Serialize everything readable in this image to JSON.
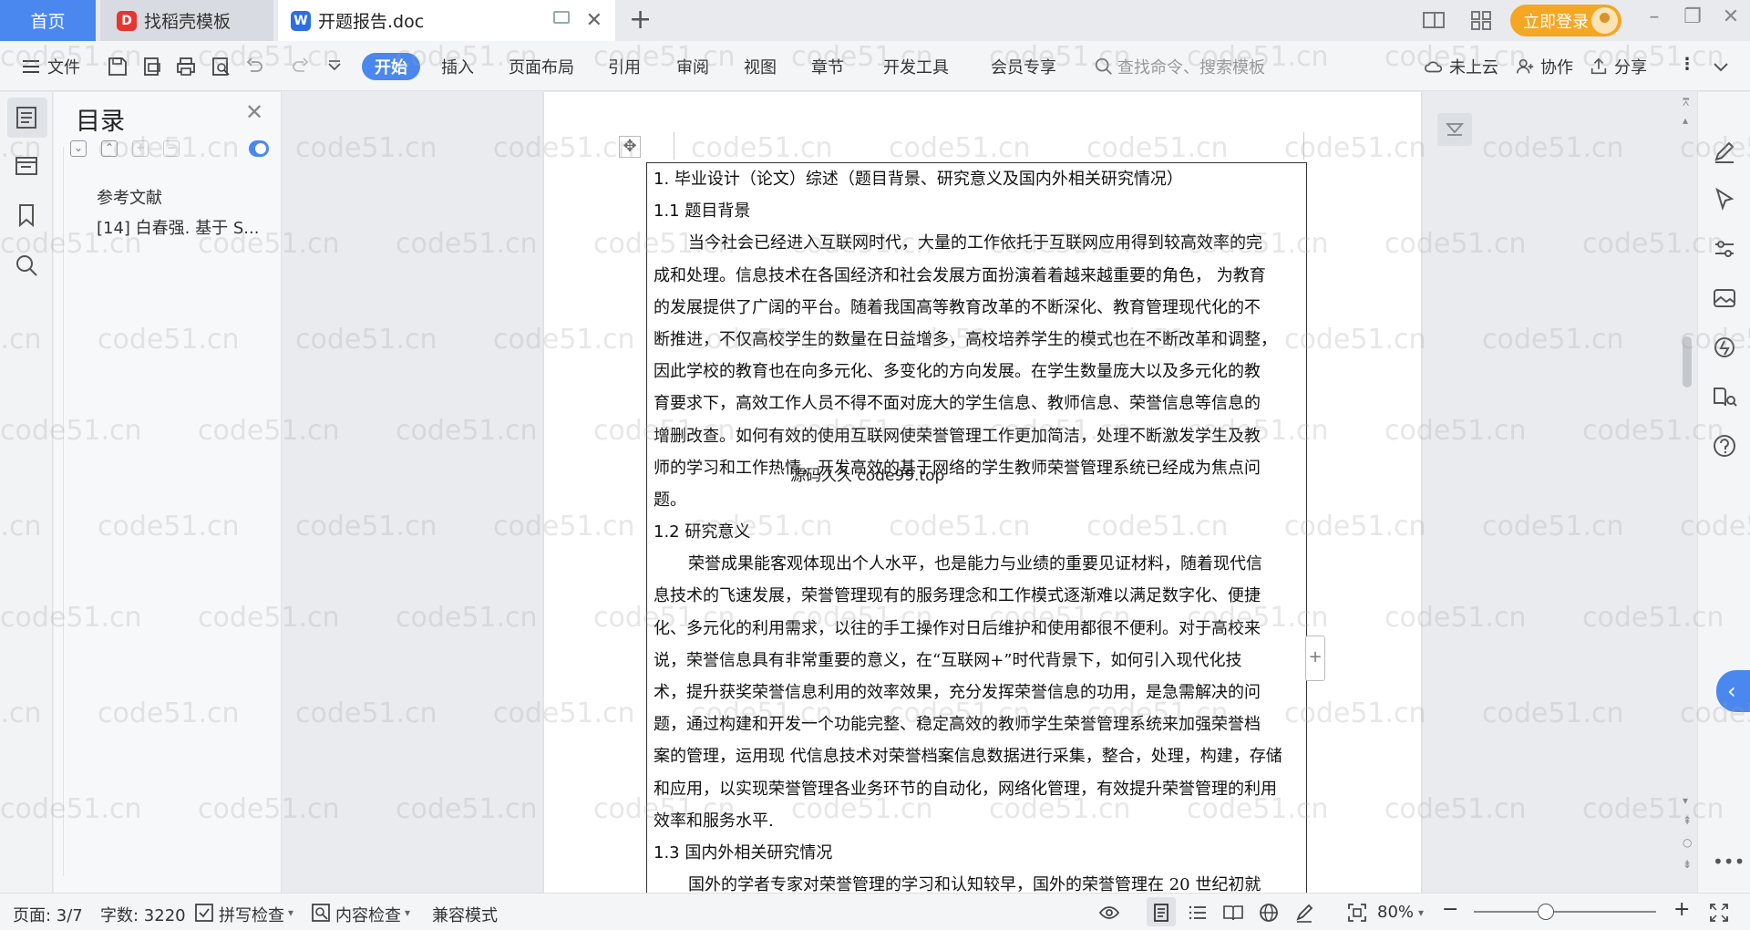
{
  "titlebar": {
    "tabs": [
      {
        "label": "首页"
      },
      {
        "label": "找稻壳模板"
      },
      {
        "label": "开题报告.doc"
      }
    ],
    "login_label": "立即登录"
  },
  "ribbon": {
    "file_label": "文件",
    "menus": [
      "开始",
      "插入",
      "页面布局",
      "引用",
      "审阅",
      "视图",
      "章节",
      "开发工具",
      "会员专享"
    ],
    "search_placeholder": "查找命令、搜索模板",
    "cloud_label": "未上云",
    "collab_label": "协作",
    "share_label": "分享"
  },
  "toc": {
    "title": "目录",
    "items": [
      "参考文献",
      "[14] 白春强. 基于 S..."
    ]
  },
  "document": {
    "lines": [
      {
        "text": "1. 毕业设计（论文）综述（题目背景、研究意义及国内外相关研究情况）",
        "style": "heading"
      },
      {
        "text": "1.1  题目背景",
        "style": "heading"
      },
      {
        "text": "当今社会已经进入互联网时代，大量的工作依托于互联网应用得到较高效率的完",
        "style": "first"
      },
      {
        "text": "成和处理。信息技术在各国经济和社会发展方面扮演着着越来越重要的角色， 为教育",
        "style": "body"
      },
      {
        "text": "的发展提供了广阔的平台。随着我国高等教育改革的不断深化、教育管理现代化的不",
        "style": "body"
      },
      {
        "text": "断推进，不仅高校学生的数量在日益增多，高校培养学生的模式也在不断改革和调整，",
        "style": "body"
      },
      {
        "text": "因此学校的教育也在向多元化、多变化的方向发展。在学生数量庞大以及多元化的教",
        "style": "body"
      },
      {
        "text": "育要求下，高效工作人员不得不面对庞大的学生信息、教师信息、荣誉信息等信息的",
        "style": "body"
      },
      {
        "text": "增删改查。如何有效的使用互联网使荣誉管理工作更加简洁，处理不断激发学生及教",
        "style": "body"
      },
      {
        "text": "师的学习和工作热情，开发高效的基于网络的学生教师荣誉管理系统已经成为焦点问",
        "style": "body"
      },
      {
        "text": "题。",
        "style": "body"
      },
      {
        "text": "1.2  研究意义",
        "style": "heading"
      },
      {
        "text": "荣誉成果能客观体现出个人水平，也是能力与业绩的重要见证材料，随着现代信",
        "style": "first"
      },
      {
        "text": "息技术的飞速发展，荣誉管理现有的服务理念和工作模式逐渐难以满足数字化、便捷",
        "style": "body"
      },
      {
        "text": "化、多元化的利用需求，以往的手工操作对日后维护和使用都很不便利。对于高校来",
        "style": "body"
      },
      {
        "text": "说，荣誉信息具有非常重要的意义，在“互联网+”时代背景下，如何引入现代化技",
        "style": "body"
      },
      {
        "text": "术，提升获奖荣誉信息利用的效率效果，充分发挥荣誉信息的功用，是急需解决的问",
        "style": "body"
      },
      {
        "text": "题，通过构建和开发一个功能完整、稳定高效的教师学生荣誉管理系统来加强荣誉档",
        "style": "body"
      },
      {
        "text": "案的管理，运用现 代信息技术对荣誉档案信息数据进行采集，整合，处理，构建，存储",
        "style": "body"
      },
      {
        "text": "和应用，以实现荣誉管理各业务环节的自动化，网络化管理，有效提升荣誉管理的利用",
        "style": "body"
      },
      {
        "text": "效率和服务水平.",
        "style": "body"
      },
      {
        "text": "1.3  国内外相关研究情况",
        "style": "heading"
      },
      {
        "text": "国外的学者专家对荣誉管理的学习和认知较早，国外的荣誉管理在 20 世纪初就",
        "style": "first"
      }
    ],
    "overlay_text": "源码久久 code99.top"
  },
  "statusbar": {
    "page": "页面: 3/7",
    "words": "字数: 3220",
    "spell_check": "拼写检查",
    "content_check": "内容检查",
    "compat_mode": "兼容模式",
    "zoom": "80%"
  },
  "watermark_text": "code51.cn",
  "colors": {
    "accent": "#4a88f0",
    "login": "#f5a623",
    "wps_red": "#e8352e"
  }
}
